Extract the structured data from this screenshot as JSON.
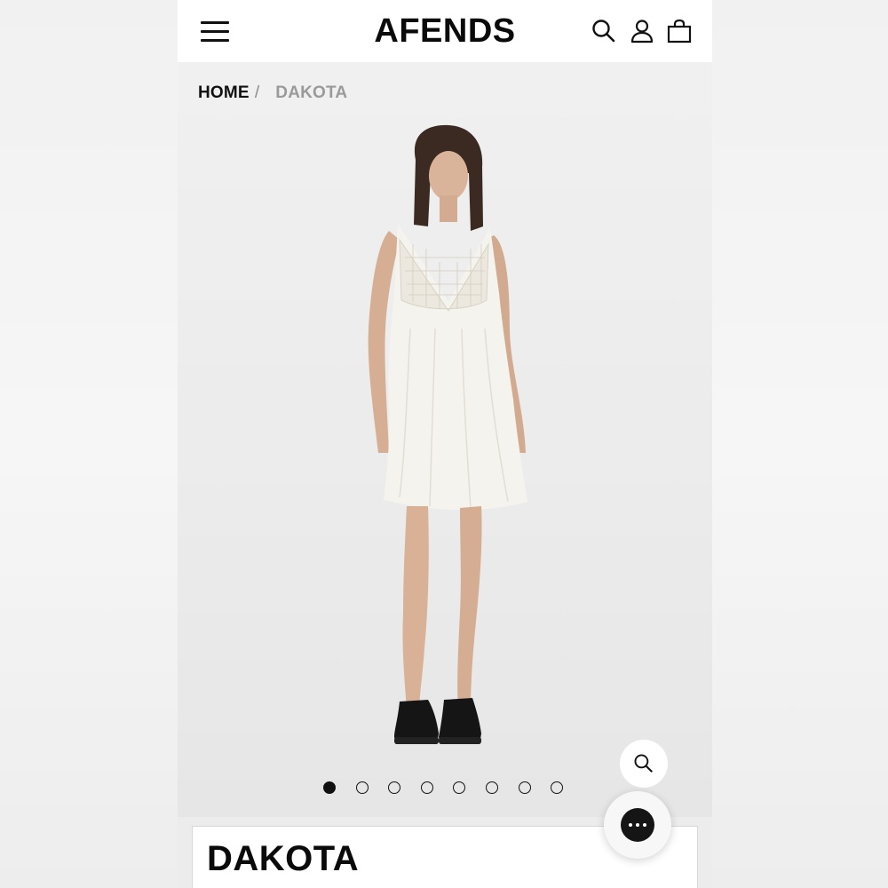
{
  "header": {
    "logo": "AFENDS",
    "icons": [
      "menu-icon",
      "search-icon",
      "account-icon",
      "bag-icon"
    ]
  },
  "breadcrumb": {
    "home": "HOME",
    "separator": "/",
    "current": "DAKOTA"
  },
  "gallery": {
    "image_count": 8,
    "active_index": 0
  },
  "product": {
    "title": "DAKOTA"
  },
  "colors": {
    "text": "#111111",
    "muted": "#9a9a9a",
    "background": "#ececec",
    "dress": "#f5f3ee",
    "shoes": "#151515"
  }
}
